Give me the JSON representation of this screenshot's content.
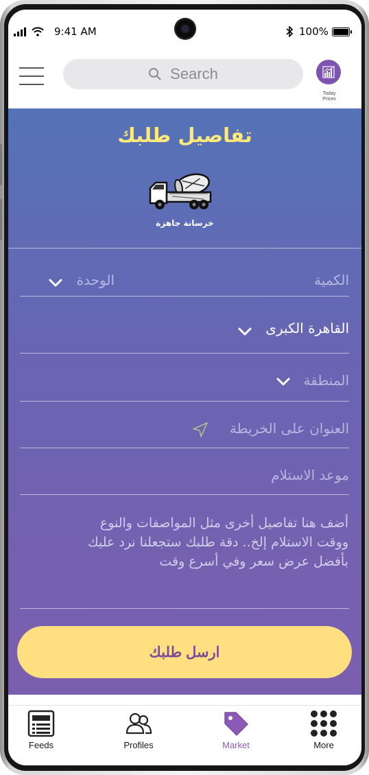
{
  "status_bar": {
    "time": "9:41 AM",
    "battery": "100%"
  },
  "header": {
    "search_placeholder": "Search",
    "prices_line1": "Today",
    "prices_line2": "Prices"
  },
  "page": {
    "title": "تفاصيل طلبك",
    "product_label": "خرسانة جاهزة"
  },
  "form": {
    "quantity_placeholder": "الكمية",
    "unit_placeholder": "الوحدة",
    "city_value": "القاهرة الكبرى",
    "area_placeholder": "المنطقة",
    "address_placeholder": "العنوان على الخريطة",
    "delivery_placeholder": "موعد الاستلام",
    "notes_placeholder": "أضف هنا تفاصيل أخرى مثل المواصفات والنوع\nووقت الاستلام إلخ.. دقة طلبك ستجعلنا نرد عليك\nبأفضل عرض سعر وفي أسرع وقت",
    "submit_label": "ارسل طلبك"
  },
  "tabs": [
    {
      "label": "Feeds",
      "active": false
    },
    {
      "label": "Profiles",
      "active": false
    },
    {
      "label": "Market",
      "active": true
    },
    {
      "label": "More",
      "active": false
    }
  ],
  "colors": {
    "accent_purple": "#8b5ab6",
    "title_yellow": "#ffe97a",
    "button_yellow": "#ffdf80"
  }
}
